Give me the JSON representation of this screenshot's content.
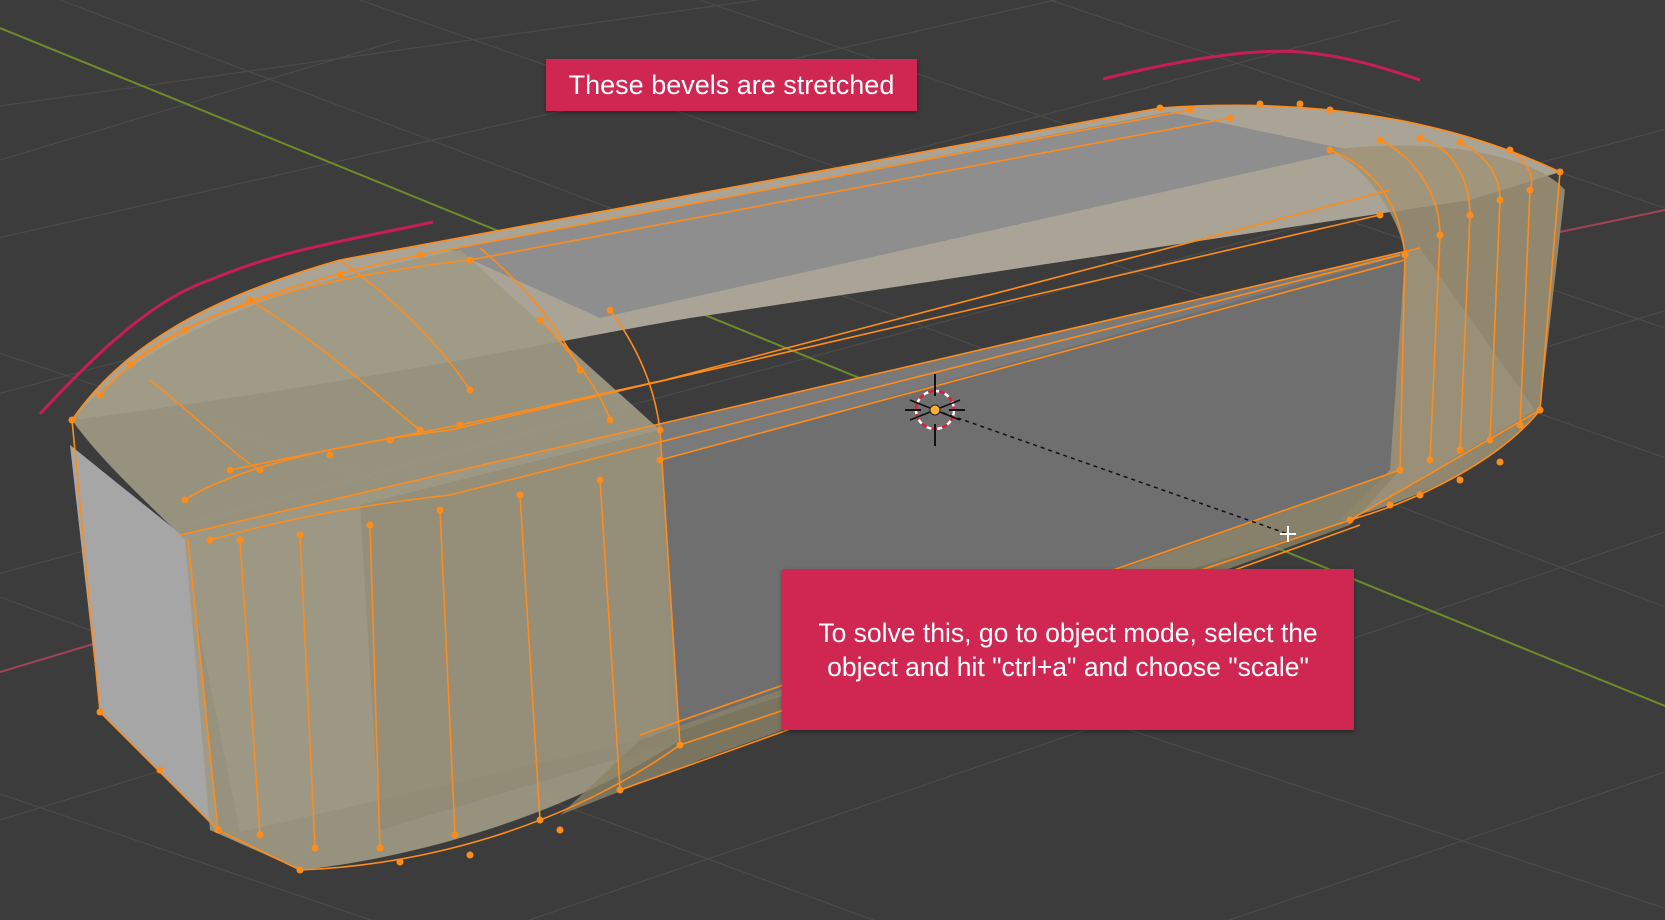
{
  "annotations": {
    "top_label": "These bevels are stretched",
    "bottom_line1": "To solve this, go to object mode, select the",
    "bottom_line2": "object and hit \"ctrl+a\" and choose \"scale\""
  },
  "colors": {
    "background": "#3c3c3c",
    "grid": "#4a4a4a",
    "x_axis": "#b24a5c",
    "y_axis": "#6e8c2a",
    "selection": "#ff8c1a",
    "mesh_face": "#8f8a7a",
    "callout": "#cf2652",
    "curve_marker": "#c81e55"
  },
  "icons": {
    "cursor": "3d-cursor-icon",
    "origin": "object-origin-icon",
    "transform": "transform-crosshair-icon"
  }
}
